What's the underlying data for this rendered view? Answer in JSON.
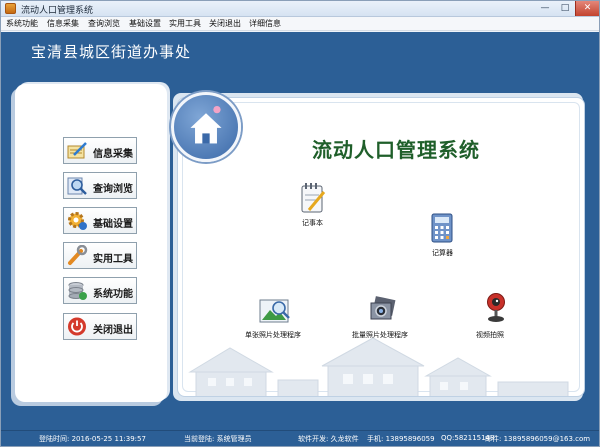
{
  "window": {
    "title": "流动人口管理系统",
    "min_glyph": "—",
    "max_glyph": "□",
    "close_glyph": "✕"
  },
  "menu": [
    {
      "label": "系统功能"
    },
    {
      "label": "信息采集"
    },
    {
      "label": "查询浏览"
    },
    {
      "label": "基础设置"
    },
    {
      "label": "实用工具"
    },
    {
      "label": "关闭退出"
    },
    {
      "label": "详细信息"
    }
  ],
  "org_title": "宝清县城区街道办事处",
  "system_title": "流动人口管理系统",
  "nav": [
    {
      "label": "信息采集",
      "icon": "notebook-pen-icon"
    },
    {
      "label": "查询浏览",
      "icon": "magnifier-icon"
    },
    {
      "label": "基础设置",
      "icon": "gear-icon"
    },
    {
      "label": "实用工具",
      "icon": "wrench-icon"
    },
    {
      "label": "系统功能",
      "icon": "database-icon"
    },
    {
      "label": "关闭退出",
      "icon": "power-icon"
    }
  ],
  "tools": [
    {
      "label": "记事本",
      "icon": "notepad-icon"
    },
    {
      "label": "记算器",
      "icon": "calculator-icon"
    },
    {
      "label": "单张照片处理程序",
      "icon": "photo-icon"
    },
    {
      "label": "批量照片处理程序",
      "icon": "photo-batch-icon"
    },
    {
      "label": "视频拍照",
      "icon": "webcam-icon"
    }
  ],
  "status": {
    "login_time": "登陆时间:  2016-05-25 11:39:57",
    "current_user": "当前登陆:  系统管理员",
    "developer": "软件开发: 久龙软件",
    "phone": "手机: 13895896059",
    "qq": "QQ:582115148",
    "email": "邮件: 13895896059@163.com"
  },
  "colors": {
    "main_blue": "#2c5f96",
    "title_green": "#1f5f2a",
    "close_red": "#c2432f"
  }
}
